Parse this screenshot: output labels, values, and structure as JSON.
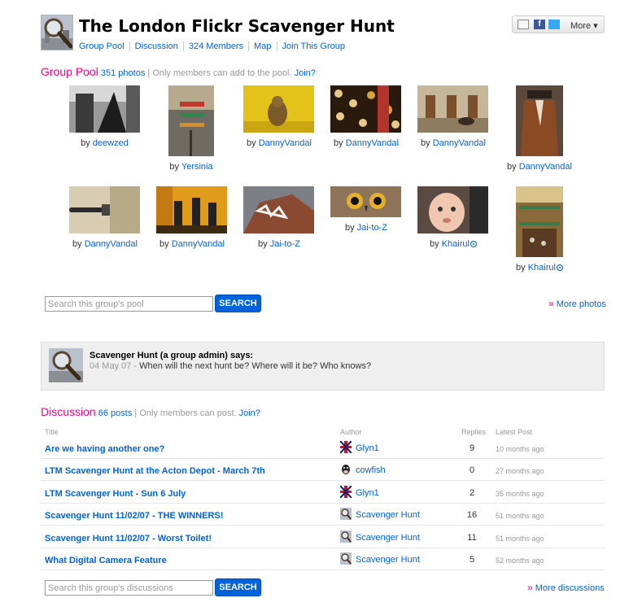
{
  "header": {
    "title": "The London Flickr Scavenger Hunt",
    "nav": [
      "Group Pool",
      "Discussion",
      "324 Members",
      "Map",
      "Join This Group"
    ],
    "share_more": "More"
  },
  "pool": {
    "heading": "Group Pool",
    "count": "351 photos",
    "separator": "|",
    "note": "Only members can add to the pool.",
    "join": "Join?",
    "by": "by",
    "photos": [
      {
        "author": "deewzed",
        "pro": false
      },
      {
        "author": "Yersinia",
        "pro": false
      },
      {
        "author": "DannyVandal",
        "pro": false
      },
      {
        "author": "DannyVandal",
        "pro": false
      },
      {
        "author": "DannyVandal",
        "pro": false
      },
      {
        "author": "DannyVandal",
        "pro": false
      },
      {
        "author": "DannyVandal",
        "pro": false
      },
      {
        "author": "DannyVandal",
        "pro": false
      },
      {
        "author": "Jai-to-Z",
        "pro": false
      },
      {
        "author": "Jai-to-Z",
        "pro": false
      },
      {
        "author": "Khairul",
        "pro": true
      },
      {
        "author": "Khairul",
        "pro": true
      }
    ],
    "search_placeholder": "Search this group's pool",
    "search_button": "SEARCH",
    "more_label": "More photos"
  },
  "admin": {
    "says": "Scavenger Hunt (a group admin) says:",
    "date": "04 May 07 -",
    "message": "When will the next hunt be? Where will it be? Who knows?"
  },
  "discussion": {
    "heading": "Discussion",
    "count": "66 posts",
    "separator": "|",
    "note": "Only members can post.",
    "join": "Join?",
    "columns": {
      "title": "Title",
      "author": "Author",
      "replies": "Replies",
      "latest": "Latest Post"
    },
    "rows": [
      {
        "title": "Are we having another one?",
        "author": "Glyn1",
        "icon": "flag",
        "replies": "9",
        "latest": "10 months ago"
      },
      {
        "title": "LTM Scavenger Hunt at the Acton Depot - March 7th",
        "author": "cowfish",
        "icon": "cow",
        "replies": "0",
        "latest": "27 months ago"
      },
      {
        "title": "LTM Scavenger Hunt - Sun 6 July",
        "author": "Glyn1",
        "icon": "flag",
        "replies": "2",
        "latest": "35 months ago"
      },
      {
        "title": "Scavenger Hunt 11/02/07 - THE WINNERS!",
        "author": "Scavenger Hunt",
        "icon": "magnifier",
        "replies": "16",
        "latest": "51 months ago"
      },
      {
        "title": "Scavenger Hunt 11/02/07 - Worst Toilet!",
        "author": "Scavenger Hunt",
        "icon": "magnifier",
        "replies": "11",
        "latest": "51 months ago"
      },
      {
        "title": "What Digital Camera Feature",
        "author": "Scavenger Hunt",
        "icon": "magnifier",
        "replies": "5",
        "latest": "52 months ago"
      }
    ],
    "search_placeholder": "Search this group's discussions",
    "search_button": "SEARCH",
    "more_label": "More discussions"
  },
  "colors": {
    "link": "#0063dc",
    "pink": "#ff0084",
    "button": "#0063dc"
  }
}
